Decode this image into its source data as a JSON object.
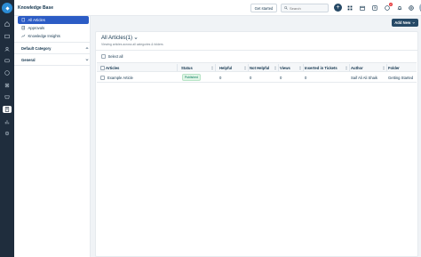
{
  "app": {
    "title": "Knowledge Base"
  },
  "rail": {
    "icons": [
      "home-icon",
      "inbox-icon",
      "contacts-icon",
      "tickets-icon",
      "reports-icon",
      "automation-icon",
      "marketplace-icon",
      "book-icon",
      "knowledge-base-icon",
      "analytics-icon",
      "settings-icon"
    ],
    "active": "knowledge-base-icon"
  },
  "topbar": {
    "get_started_label": "Get started",
    "search_placeholder": "Search",
    "notification_count": "2"
  },
  "sidebar": {
    "items": [
      {
        "label": "All Articles",
        "icon": "document-icon",
        "active": true
      },
      {
        "label": "Approvals",
        "icon": "check-document-icon",
        "active": false
      },
      {
        "label": "Knowledge Insights",
        "icon": "chart-icon",
        "active": false
      }
    ],
    "sections": [
      {
        "label": "Default Category"
      },
      {
        "label": "General"
      }
    ]
  },
  "toolbar": {
    "add_new_label": "Add New"
  },
  "main": {
    "title": "All Articles(1)",
    "subtitle": "Viewing articles across all categories & folders",
    "select_all_label": "Select all",
    "columns": [
      "Articles",
      "Status",
      "Helpful",
      "Not Helpful",
      "Views",
      "Inserted in Tickets",
      "Author",
      "Folder"
    ],
    "rows": [
      {
        "article": "Example Article",
        "status": "Published",
        "helpful": "0",
        "not_helpful": "0",
        "views": "0",
        "inserted": "0",
        "author": "Saif Ali Ali Shaik",
        "folder": "Getting Started"
      }
    ]
  },
  "colors": {
    "accent": "#2c5cc5",
    "rail": "#1f2d3d",
    "primary_button": "#264966",
    "published": "#00795b"
  }
}
